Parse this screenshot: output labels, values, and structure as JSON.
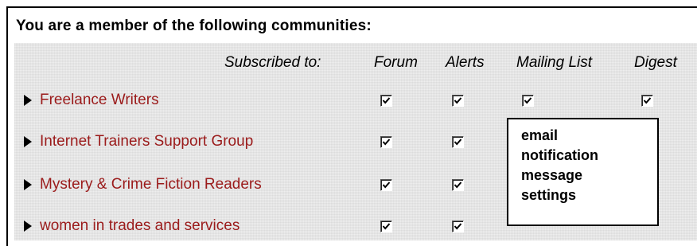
{
  "heading": "You are a member of the following communities:",
  "columns": {
    "subscribed_to": "Subscribed to:",
    "forum": "Forum",
    "alerts": "Alerts",
    "mailing_list": "Mailing List",
    "digest": "Digest"
  },
  "communities": [
    {
      "name": "Freelance Writers",
      "forum": true,
      "alerts": true,
      "mailing_list": true,
      "digest": true
    },
    {
      "name": "Internet Trainers Support Group",
      "forum": true,
      "alerts": true
    },
    {
      "name": "Mystery & Crime Fiction Readers",
      "forum": true,
      "alerts": true
    },
    {
      "name": "women in trades and services",
      "forum": true,
      "alerts": true
    }
  ],
  "callout": {
    "lines": [
      "email",
      "notification",
      "message",
      "settings"
    ]
  },
  "colors": {
    "link": "#9b1b1b",
    "panel_bg": "#eeeeee"
  },
  "icons": {
    "bullet": "triangle-right-icon",
    "check": "checkmark-icon"
  }
}
